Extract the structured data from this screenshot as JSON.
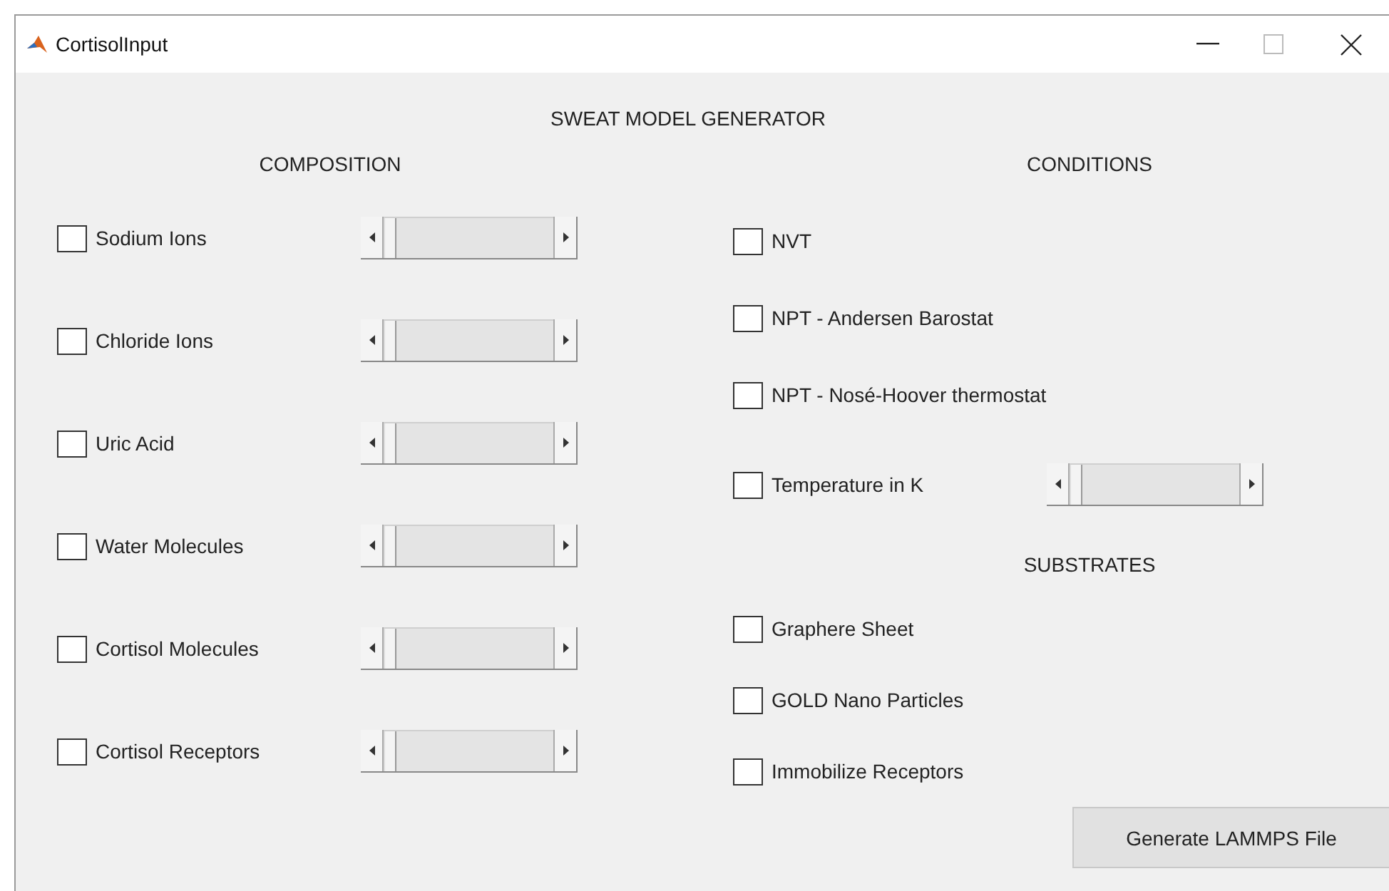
{
  "window": {
    "title": "CortisolInput"
  },
  "heading": "SWEAT MODEL GENERATOR",
  "composition": {
    "title": "COMPOSITION",
    "items": [
      {
        "kind": "slider",
        "label": "Sodium Ions",
        "checked": false,
        "level": 0
      },
      {
        "kind": "slider",
        "label": "Chloride Ions",
        "checked": false,
        "level": 0
      },
      {
        "kind": "slider",
        "label": "Uric Acid",
        "checked": false,
        "level": 0
      },
      {
        "kind": "slider",
        "label": "Water Molecules",
        "checked": false,
        "level": 0
      },
      {
        "kind": "slider",
        "label": "Cortisol Molecules",
        "checked": false,
        "level": 0
      },
      {
        "kind": "slider",
        "label": "Cortisol Receptors",
        "checked": false,
        "level": 0
      }
    ]
  },
  "conditions": {
    "title": "CONDITIONS",
    "items": [
      {
        "kind": "checkbox",
        "label": "NVT",
        "checked": false
      },
      {
        "kind": "checkbox",
        "label": "NPT - Andersen Barostat",
        "checked": false
      },
      {
        "kind": "checkbox",
        "label": "NPT - Nosé-Hoover thermostat",
        "checked": false
      },
      {
        "kind": "slider",
        "label": "Temperature in K",
        "checked": false,
        "level": 0
      }
    ]
  },
  "substrates": {
    "title": "SUBSTRATES",
    "items": [
      {
        "kind": "checkbox",
        "label": "Graphere Sheet",
        "checked": false
      },
      {
        "kind": "checkbox",
        "label": "GOLD Nano Particles",
        "checked": false
      },
      {
        "kind": "checkbox",
        "label": "Immobilize Receptors",
        "checked": false
      }
    ]
  },
  "button": "Generate LAMMPS File"
}
